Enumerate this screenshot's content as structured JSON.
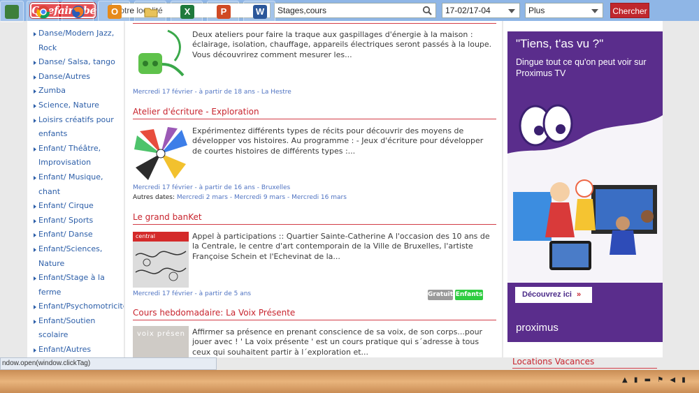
{
  "header": {
    "logo_text": "Quefaire.be",
    "location_placeholder": "Votre localité",
    "category_value": "Stages,cours",
    "date_value": "17-02/17-04",
    "more_value": "Plus",
    "search_label": "Chercher"
  },
  "sidebar": {
    "items": [
      {
        "label": "Danse/Modern Jazz, Rock"
      },
      {
        "label": "Danse/ Salsa, tango"
      },
      {
        "label": "Danse/Autres"
      },
      {
        "label": "Zumba"
      },
      {
        "label": "Science, Nature"
      },
      {
        "label": "Loisirs créatifs pour enfants"
      },
      {
        "label": "Enfant/ Théâtre, Improvisation"
      },
      {
        "label": "Enfant/ Musique, chant"
      },
      {
        "label": "Enfant/ Cirque"
      },
      {
        "label": "Enfant/ Sports"
      },
      {
        "label": "Enfant/ Danse"
      },
      {
        "label": "Enfant/Sciences, Nature"
      },
      {
        "label": "Enfant/Stage à la ferme"
      },
      {
        "label": "Enfant/Psychomotricité"
      },
      {
        "label": "Enfant/Soutien scolaire"
      },
      {
        "label": "Enfant/Autres"
      }
    ]
  },
  "events": [
    {
      "title": "",
      "description": "Deux ateliers pour faire la traque aux gaspillages d'énergie à la maison : éclairage, isolation, chauffage, appareils électriques seront passés à la loupe. Vous découvrirez comment mesurer les...",
      "meta": "Mercredi 17 février - à partir de 18 ans - La Hestre"
    },
    {
      "title": "Atelier d'écriture - Exploration",
      "description": "Expérimentez différents types de récits pour découvrir des moyens de développer vos histoires. Au programme : - Jeux d'écriture pour développer de courtes histoires de différents types :...",
      "meta": "Mercredi 17 février - à partir de 16 ans - Bruxelles",
      "other_label": "Autres dates:",
      "other_dates": "Mercredi 2 mars - Mercredi 9 mars - Mercredi 16 mars"
    },
    {
      "title": "Le grand banKet",
      "description": "Appel à participations :: Quartier Sainte-Catherine A l'occasion des 10 ans de la Centrale, le centre d'art contemporain de la Ville de Bruxelles, l'artiste Françoise Schein et l'Echevinat de la...",
      "meta": "Mercredi 17 février - à partir de 5 ans",
      "thumb_label": "central",
      "badges": [
        "Gratuit",
        "Enfants"
      ]
    },
    {
      "title": "Cours hebdomadaire: La Voix Présente",
      "description": "Affirmer sa présence en prenant conscience de sa voix, de son corps...pour jouer avec ! ' La voix présente ' est un cours pratique qui s´adresse à tous ceux qui souhaitent partir à l´exploration et...",
      "thumb_label": "voix présen"
    }
  ],
  "ad": {
    "headline": "\"Tiens, t'as vu ?\"",
    "subline": "Dingue tout ce qu'on peut voir sur Proximus TV",
    "cta": "Découvrez ici",
    "brand": "proximus"
  },
  "right": {
    "section_title": "Locations Vacances"
  },
  "statusbar": {
    "text": "ndow.open(window.clickTag)"
  },
  "colors": {
    "accent_red": "#c8242e",
    "link_blue": "#4f73c2",
    "topbar_blue": "#8fb6e6",
    "ad_purple": "#5a2d8c",
    "badge_gray": "#9a9a9a",
    "badge_green": "#2ecc40"
  }
}
